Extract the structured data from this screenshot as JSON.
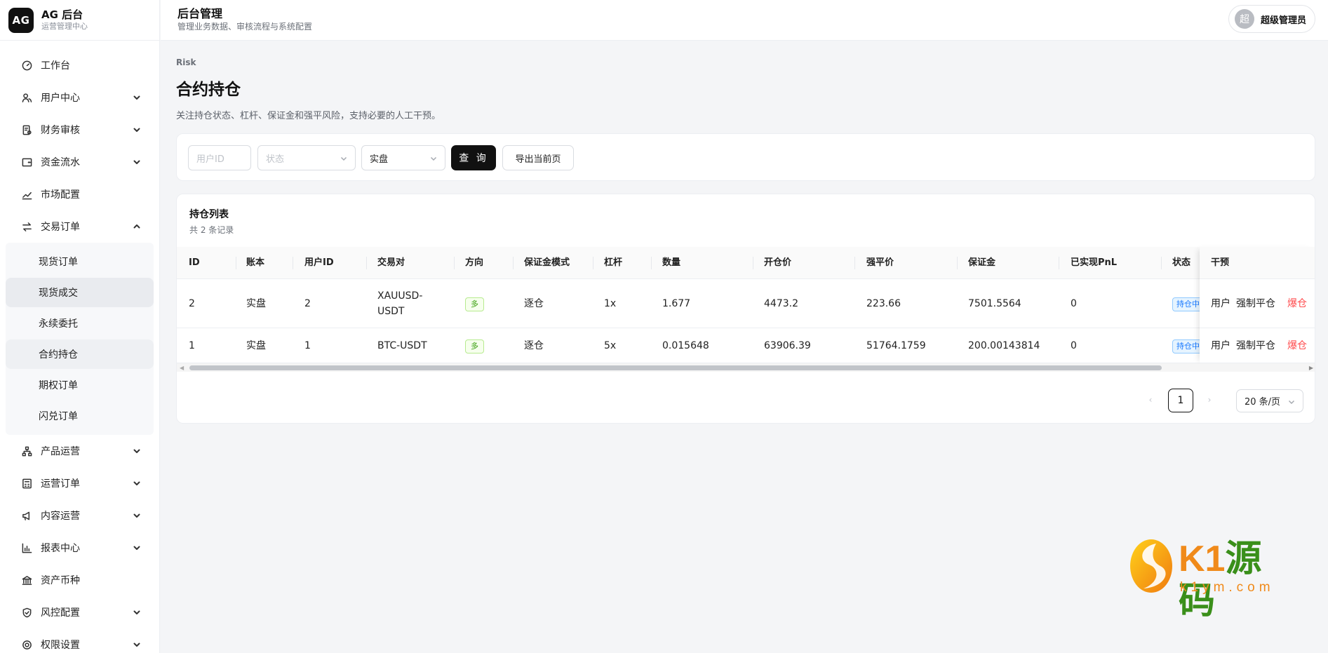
{
  "brand": {
    "logo": "AG",
    "title": "AG 后台",
    "subtitle": "运营管理中心"
  },
  "sidebar": {
    "items": [
      {
        "label": "工作台",
        "icon": "dashboard-icon"
      },
      {
        "label": "用户中心",
        "icon": "users-icon"
      },
      {
        "label": "财务审核",
        "icon": "audit-icon"
      },
      {
        "label": "资金流水",
        "icon": "wallet-icon"
      },
      {
        "label": "市场配置",
        "icon": "chart-line-icon"
      },
      {
        "label": "交易订单",
        "icon": "swap-icon"
      },
      {
        "label": "产品运营",
        "icon": "sitemap-icon"
      },
      {
        "label": "运营订单",
        "icon": "calculator-icon"
      },
      {
        "label": "内容运营",
        "icon": "megaphone-icon"
      },
      {
        "label": "报表中心",
        "icon": "bar-chart-icon"
      },
      {
        "label": "资产币种",
        "icon": "bank-icon"
      },
      {
        "label": "风控配置",
        "icon": "shield-icon"
      },
      {
        "label": "权限设置",
        "icon": "gear-icon"
      }
    ],
    "trade_sub": [
      "现货订单",
      "现货成交",
      "永续委托",
      "合约持仓",
      "期权订单",
      "闪兑订单"
    ]
  },
  "header": {
    "title": "后台管理",
    "subtitle": "管理业务数据、审核流程与系统配置",
    "avatar": "超",
    "user": "超级管理员"
  },
  "page": {
    "crumb": "Risk",
    "title": "合约持仓",
    "desc": "关注持仓状态、杠杆、保证金和强平风险，支持必要的人工干预。"
  },
  "filters": {
    "user_id_placeholder": "用户ID",
    "status_placeholder": "状态",
    "account_value": "实盘",
    "query_label": "查 询",
    "export_label": "导出当前页"
  },
  "table": {
    "title": "持仓列表",
    "count": "共 2 条记录",
    "columns": [
      "ID",
      "账本",
      "用户ID",
      "交易对",
      "方向",
      "保证金模式",
      "杠杆",
      "数量",
      "开仓价",
      "强平价",
      "保证金",
      "已实现PnL",
      "状态",
      "干预"
    ],
    "rows": [
      {
        "id": "2",
        "book": "实盘",
        "uid": "2",
        "pair_l1": "XAUUSD-",
        "pair_l2": "USDT",
        "side": "多",
        "mode": "逐仓",
        "lev": "1x",
        "qty": "1.677",
        "open": "4473.2",
        "liq": "223.66",
        "margin": "7501.5564",
        "pnl": "0",
        "status": "持仓中"
      },
      {
        "id": "1",
        "book": "实盘",
        "uid": "1",
        "pair_l1": "BTC-USDT",
        "pair_l2": "",
        "side": "多",
        "mode": "逐仓",
        "lev": "5x",
        "qty": "0.015648",
        "open": "63906.39",
        "liq": "51764.1759",
        "margin": "200.00143814",
        "pnl": "0",
        "status": "持仓中"
      }
    ],
    "actions": {
      "user": "用户",
      "force": "强制平仓",
      "liquidate": "爆仓"
    }
  },
  "pagination": {
    "prev": "‹",
    "page": "1",
    "next": "›",
    "page_size": "20 条/页"
  },
  "watermark": {
    "k1": "K1",
    "ym": "源码",
    "url": "k1ym.com"
  },
  "colors": {
    "accent": "#111111",
    "danger": "#ff4d4f",
    "tag_green": "#389e0d",
    "tag_blue": "#1677ff"
  }
}
